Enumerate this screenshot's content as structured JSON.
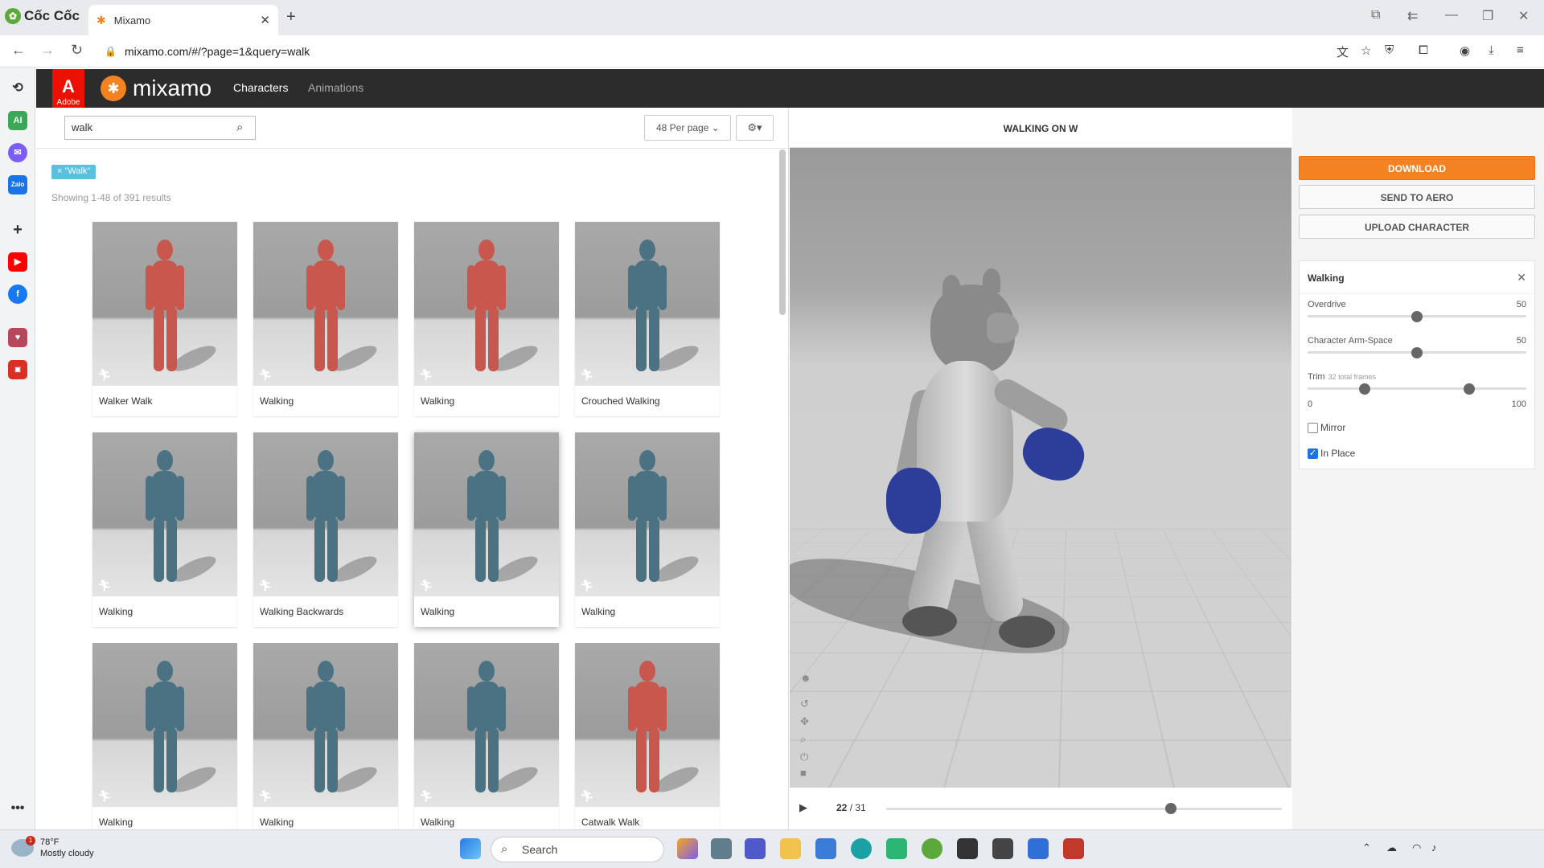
{
  "browser": {
    "brand": "Cốc Cốc",
    "tab_title": "Mixamo",
    "url": "mixamo.com/#/?page=1&query=walk"
  },
  "header": {
    "adobe": "Adobe",
    "logo": "mixamo",
    "nav": [
      "Characters",
      "Animations"
    ]
  },
  "search": {
    "value": "walk",
    "per_page": "48 Per page",
    "tag": "× \"Walk\"",
    "showing": "Showing 1-48 of 391 results"
  },
  "cards": [
    {
      "name": "Walker Walk",
      "color": "#c8574e"
    },
    {
      "name": "Walking",
      "color": "#c8574e"
    },
    {
      "name": "Walking",
      "color": "#c8574e"
    },
    {
      "name": "Crouched Walking",
      "color": "#4b7283"
    },
    {
      "name": "Walking",
      "color": "#4b7283"
    },
    {
      "name": "Walking Backwards",
      "color": "#4b7283"
    },
    {
      "name": "Walking",
      "color": "#4b7283"
    },
    {
      "name": "Walking",
      "color": "#4b7283"
    },
    {
      "name": "Walking",
      "color": "#4b7283"
    },
    {
      "name": "Walking",
      "color": "#4b7283"
    },
    {
      "name": "Walking",
      "color": "#4b7283"
    },
    {
      "name": "Catwalk Walk",
      "color": "#c8574e"
    }
  ],
  "preview": {
    "title": "WALKING ON W",
    "frame_current": "22",
    "frame_total": "/ 31",
    "progress": 0.72
  },
  "actions": {
    "download": "DOWNLOAD",
    "send": "SEND TO AERO",
    "upload": "UPLOAD CHARACTER"
  },
  "settings": {
    "title": "Walking",
    "overdrive_label": "Overdrive",
    "overdrive_value": "50",
    "overdrive": 0.5,
    "armspace_label": "Character Arm-Space",
    "armspace_value": "50",
    "armspace": 0.5,
    "trim_label": "Trim",
    "trim_note": "32 total frames",
    "trim_min": "0",
    "trim_max": "100",
    "trim_start": 0.26,
    "trim_end": 0.74,
    "mirror": "Mirror",
    "mirror_checked": false,
    "inplace": "In Place",
    "inplace_checked": true
  },
  "taskbar": {
    "temp": "78°F",
    "weather": "Mostly cloudy",
    "notif": "1",
    "search": "Search"
  },
  "colors": {
    "accent": "#f58220",
    "adobe": "#eb1000",
    "header": "#2c2c2c"
  }
}
